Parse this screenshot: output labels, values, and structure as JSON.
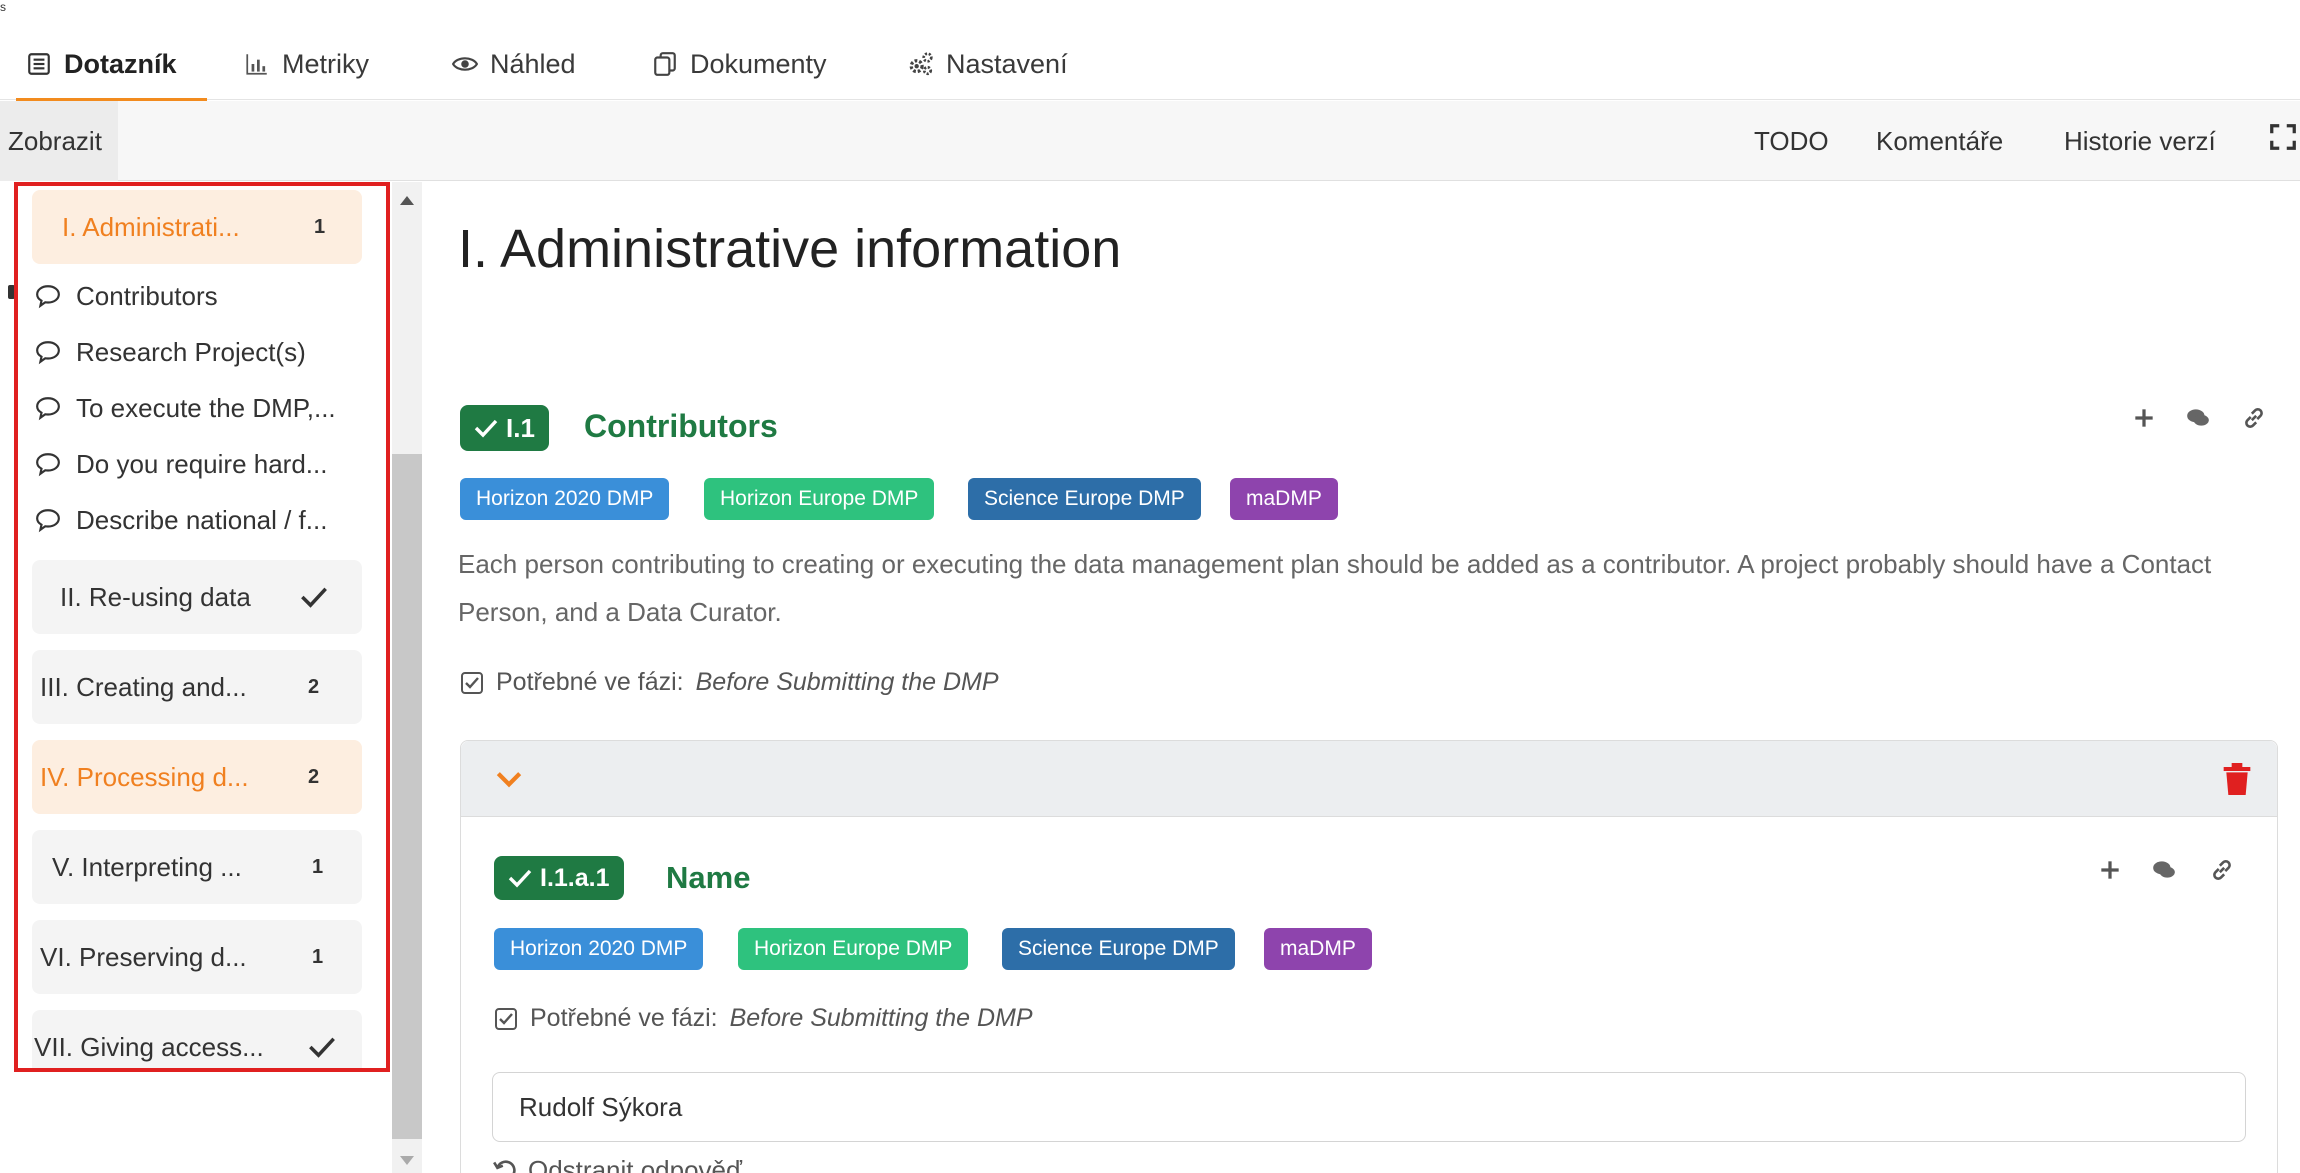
{
  "corner_mark": "s",
  "tabs": [
    {
      "label": "Dotazník",
      "icon": "list-icon",
      "active": true
    },
    {
      "label": "Metriky",
      "icon": "bar-chart-icon",
      "active": false
    },
    {
      "label": "Náhled",
      "icon": "eye-icon",
      "active": false
    },
    {
      "label": "Dokumenty",
      "icon": "copy-icon",
      "active": false
    },
    {
      "label": "Nastavení",
      "icon": "gears-icon",
      "active": false
    }
  ],
  "toolbar": {
    "view_label": "Zobrazit",
    "todo_label": "TODO",
    "comments_label": "Komentáře",
    "history_label": "Historie verzí",
    "fullscreen_icon": "expand-icon"
  },
  "sidebar": {
    "chapters": [
      {
        "label": "I. Administrati...",
        "count": "1",
        "highlight": true
      },
      {
        "label": "II. Re-using data",
        "done": true
      },
      {
        "label": "III. Creating and...",
        "count": "2"
      },
      {
        "label": "IV. Processing d...",
        "count": "2",
        "highlight": true
      },
      {
        "label": "V. Interpreting ...",
        "count": "1"
      },
      {
        "label": "VI. Preserving d...",
        "count": "1"
      },
      {
        "label": "VII. Giving access...",
        "done": true
      }
    ],
    "questions": [
      {
        "label": "Contributors"
      },
      {
        "label": "Research Project(s)"
      },
      {
        "label": "To execute the DMP,..."
      },
      {
        "label": "Do you require hard..."
      },
      {
        "label": "Describe national / f..."
      }
    ]
  },
  "main": {
    "title": "I. Administrative information",
    "question": {
      "number": "I.1",
      "title": "Contributors",
      "tags": [
        {
          "label": "Horizon 2020 DMP",
          "color": "#3a8fd9"
        },
        {
          "label": "Horizon Europe DMP",
          "color": "#2ec27e"
        },
        {
          "label": "Science Europe DMP",
          "color": "#2d6ea8"
        },
        {
          "label": "maDMP",
          "color": "#8e44ad"
        }
      ],
      "description": "Each person contributing to creating or executing the data management plan should be added as a contributor. A project probably should have a Contact Person, and a Data Curator.",
      "phase_label": "Potřebné ve fázi:",
      "phase_value": "Before Submitting the DMP"
    },
    "item": {
      "number": "I.1.a.1",
      "title": "Name",
      "tags": [
        {
          "label": "Horizon 2020 DMP",
          "color": "#3a8fd9"
        },
        {
          "label": "Horizon Europe DMP",
          "color": "#2ec27e"
        },
        {
          "label": "Science Europe DMP",
          "color": "#2d6ea8"
        },
        {
          "label": "maDMP",
          "color": "#8e44ad"
        }
      ],
      "phase_label": "Potřebné ve fázi:",
      "phase_value": "Before Submitting the DMP",
      "answer_value": "Rudolf Sýkora",
      "clear_label": "Odstranit odpověď"
    }
  },
  "colors": {
    "accent": "#f28b1e",
    "success": "#1f7a43",
    "danger": "#e02020"
  }
}
